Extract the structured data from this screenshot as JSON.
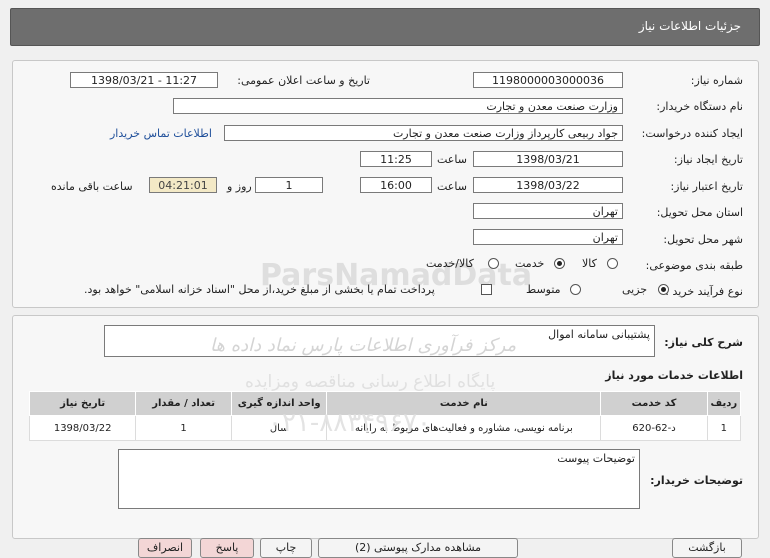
{
  "header": {
    "title": "جزئیات اطلاعات نیاز"
  },
  "details": {
    "need_number_label": "شماره نیاز:",
    "need_number": "1198000003000036",
    "announce_label": "تاریخ و ساعت اعلان عمومی:",
    "announce_value": "1398/03/21 - 11:27",
    "buyer_org_label": "نام دستگاه خریدار:",
    "buyer_org": "وزارت صنعت معدن و تجارت",
    "requester_label": "ایجاد کننده درخواست:",
    "requester": "جواد ربیعی کارپرداز وزارت صنعت معدن و تجارت",
    "contact_link": "اطلاعات تماس خریدار",
    "created_label": "تاریخ ایجاد نیاز:",
    "created_date": "1398/03/21",
    "time_label": "ساعت",
    "created_time": "11:25",
    "validity_label": "تاریخ اعتبار نیاز:",
    "validity_date": "1398/03/22",
    "validity_time": "16:00",
    "days_value": "1",
    "days_label": "روز و",
    "remaining_time": "04:21:01",
    "remaining_label": "ساعت باقی مانده",
    "province_label": "استان محل تحویل:",
    "province": "تهران",
    "city_label": "شهر محل تحویل:",
    "city": "تهران",
    "category_label": "طبقه بندی موضوعی:",
    "category_options": [
      "کالا",
      "خدمت",
      "کالا/خدمت"
    ],
    "category_selected": "خدمت",
    "process_label": "نوع فرآیند خرید :",
    "process_options": [
      "جزیی",
      "متوسط"
    ],
    "process_selected": "جزیی",
    "payment_note": "پرداخت تمام یا بخشی از مبلغ خرید،از محل \"اسناد خزانه اسلامی\" خواهد بود."
  },
  "general_desc": {
    "label": "شرح کلی نیاز:",
    "value": "پشتیبانی سامانه اموال"
  },
  "services": {
    "section_title": "اطلاعات خدمات مورد نیاز",
    "columns": [
      "ردیف",
      "کد خدمت",
      "نام خدمت",
      "واحد اندازه گیری",
      "تعداد / مقدار",
      "تاریخ نیاز"
    ],
    "rows": [
      [
        "1",
        "د-62-620",
        "برنامه نویسی، مشاوره و فعالیت‌های مربوط به رایانه",
        "سال",
        "1",
        "1398/03/22"
      ]
    ]
  },
  "buyer_notes": {
    "label": "توضیحات خریدار:",
    "value": "توضیحات پیوست"
  },
  "watermark": {
    "line1": "ParsNamadData",
    "line2": "مرکز فرآوری اطلاعات پارس نماد داده ها",
    "line3": "پایگاه اطلاع رسانی مناقصه ومزایده",
    "phone": "۰۲۱-۸۸۳۴۹۶۷۰"
  },
  "buttons": {
    "b1": "بازگشت",
    "b2": "مشاهده مدارک پیوستی (2)",
    "b3": "چاپ",
    "b4": "پاسخ",
    "b5": "انصراف"
  }
}
